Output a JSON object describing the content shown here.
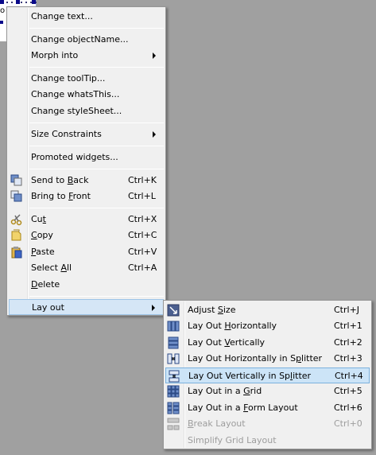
{
  "main_menu": {
    "items": [
      {
        "label": "Change text..."
      },
      {
        "label": "Change objectName..."
      },
      {
        "label": "Morph into"
      },
      {
        "label": "Change toolTip..."
      },
      {
        "label": "Change whatsThis..."
      },
      {
        "label": "Change styleSheet..."
      },
      {
        "label": "Size Constraints"
      },
      {
        "label": "Promoted widgets..."
      },
      {
        "label": "Send to Back",
        "shortcut": "Ctrl+K",
        "icon": "send-to-back-icon"
      },
      {
        "label": "Bring to Front",
        "shortcut": "Ctrl+L",
        "icon": "bring-to-front-icon"
      },
      {
        "label": "Cut",
        "shortcut": "Ctrl+X",
        "icon": "scissors-icon"
      },
      {
        "label": "Copy",
        "shortcut": "Ctrl+C",
        "icon": "copy-icon"
      },
      {
        "label": "Paste",
        "shortcut": "Ctrl+V",
        "icon": "paste-icon"
      },
      {
        "label": "Select All",
        "shortcut": "Ctrl+A"
      },
      {
        "label": "Delete"
      },
      {
        "label": "Lay out"
      }
    ]
  },
  "layout_submenu": {
    "items": [
      {
        "label": "Adjust Size",
        "shortcut": "Ctrl+J",
        "icon": "adjust-size-icon"
      },
      {
        "label": "Lay Out Horizontally",
        "shortcut": "Ctrl+1",
        "icon": "horizontal-layout-icon"
      },
      {
        "label": "Lay Out Vertically",
        "shortcut": "Ctrl+2",
        "icon": "vertical-layout-icon"
      },
      {
        "label": "Lay Out Horizontally in Splitter",
        "shortcut": "Ctrl+3",
        "icon": "horizontal-splitter-icon"
      },
      {
        "label": "Lay Out Vertically in Splitter",
        "shortcut": "Ctrl+4",
        "icon": "vertical-splitter-icon"
      },
      {
        "label": "Lay Out in a Grid",
        "shortcut": "Ctrl+5",
        "icon": "grid-layout-icon"
      },
      {
        "label": "Lay Out in a Form Layout",
        "shortcut": "Ctrl+6",
        "icon": "form-layout-icon"
      },
      {
        "label": "Break Layout",
        "shortcut": "Ctrl+0",
        "icon": "break-layout-icon"
      },
      {
        "label": "Simplify Grid Layout"
      }
    ]
  },
  "widget_fragment": {
    "text": "o"
  },
  "colors": {
    "background": "#a0a0a0",
    "menu_bg": "#f0f0f0",
    "highlight": "#cce4f7",
    "highlight_border": "#7cb1dd",
    "disabled_text": "#9d9d9d"
  }
}
